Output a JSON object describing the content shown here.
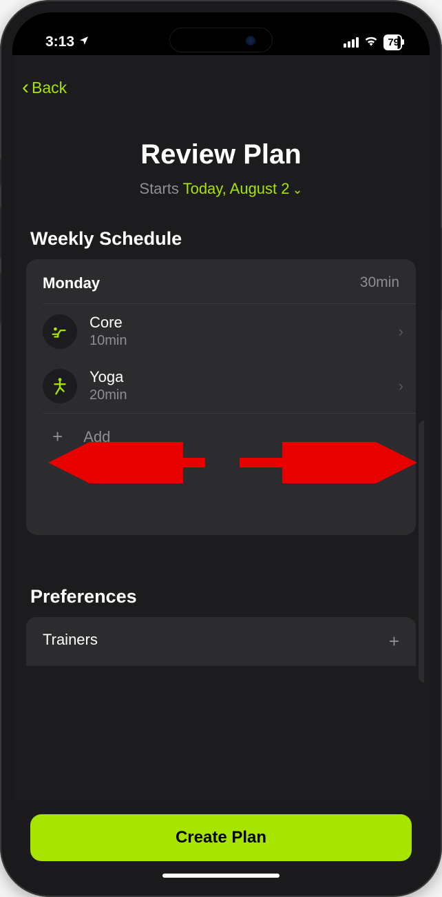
{
  "status": {
    "time": "3:13",
    "battery": "79"
  },
  "nav": {
    "back_label": "Back"
  },
  "header": {
    "title": "Review Plan",
    "starts_prefix": "Starts ",
    "starts_date": "Today, August 2"
  },
  "schedule": {
    "section_title": "Weekly Schedule",
    "day": "Monday",
    "total": "30min",
    "workouts": [
      {
        "name": "Core",
        "duration": "10min"
      },
      {
        "name": "Yoga",
        "duration": "20min"
      }
    ],
    "add_label": "Add"
  },
  "preferences": {
    "section_title": "Preferences",
    "trainers_label": "Trainers"
  },
  "cta": {
    "create_label": "Create Plan"
  }
}
